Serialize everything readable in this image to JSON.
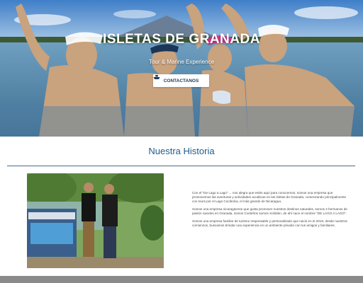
{
  "hero": {
    "title": "ISLETAS DE GRANADA",
    "subtitle": "Tour & Marine Experience",
    "contact_button_label": "CONTACTANOS",
    "contact_icon": "boat-icon"
  },
  "history": {
    "title": "Nuestra Historia",
    "paragraphs": [
      "Con el \"De Lago a Lago\" ... nos alegra que estés aquí para conocernos, somos una empresa que promovemos las aventuras y actividades acuáticas en las isletas de Granada, comenzando principalmente con tours por el Lago Cocibolca, el más grande de Nicaragua.",
      "Somos una empresa nicaragüense que gusta promover nuestros destinos naturales, somos 2 hermanos de pasión nacidos en Granada, somos Costeños somos Xolotlán, de ahí nace el nombre \"DE LAGO A LAGO\".",
      "Somos una empresa familiar de turismo responsable y personalizado que nació en el 2019, desde nuestros comienzos, buscamos brindar una experiencia en un ambiente privado con tus amigos y familiares."
    ]
  },
  "colors": {
    "title_blue": "#1d5c8c",
    "button_text": "#1f3a57",
    "rule": "#4a6a88",
    "body_text": "#4a4a4a"
  }
}
